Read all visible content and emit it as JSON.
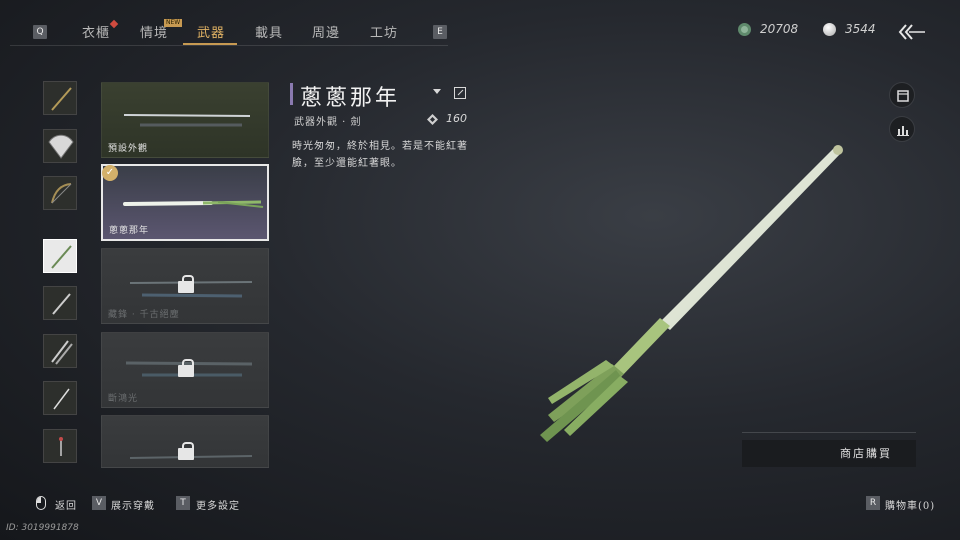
{
  "tabs": {
    "prev_key": "Q",
    "next_key": "E",
    "items": [
      {
        "label": "衣櫃"
      },
      {
        "label": "情境"
      },
      {
        "label": "武器"
      },
      {
        "label": "載具"
      },
      {
        "label": "周邊"
      },
      {
        "label": "工坊"
      }
    ],
    "active": "武器",
    "new_badge": "NEW"
  },
  "currency": {
    "jade": "20708",
    "silver": "3544"
  },
  "sidebar": {
    "icons": [
      "weapon-spear-icon",
      "fan-icon",
      "bow-icon",
      "scallion-icon",
      "blade-icon",
      "double-blade-icon",
      "sword-icon",
      "talisman-icon"
    ],
    "selected_index": 3
  },
  "skins": [
    {
      "label": "預設外觀",
      "state": "owned"
    },
    {
      "label": "蔥蔥那年",
      "state": "selected"
    },
    {
      "label": "藏鋒 · 千古絕塵",
      "state": "locked"
    },
    {
      "label": "斷鴻光",
      "state": "locked"
    },
    {
      "label": "",
      "state": "locked"
    }
  ],
  "detail": {
    "title": "蔥蔥那年",
    "category": "武器外觀 · 劍",
    "power": "160",
    "description": "時光匆匆，終於相見。若是不能紅著臉，至少還能紅著眼。"
  },
  "actions": {
    "shop_buy": "商店購買"
  },
  "footer": {
    "back": "返回",
    "show_outfit_key": "V",
    "show_outfit": "展示穿戴",
    "more_settings_key": "T",
    "more_settings": "更多設定",
    "cart_key": "R",
    "cart": "購物車(0)",
    "player_id": "ID: 3019991878"
  },
  "colors": {
    "accent_gold": "#c79a52",
    "selected_border": "#e8e8e8",
    "title_bar": "#8a7ab0"
  }
}
